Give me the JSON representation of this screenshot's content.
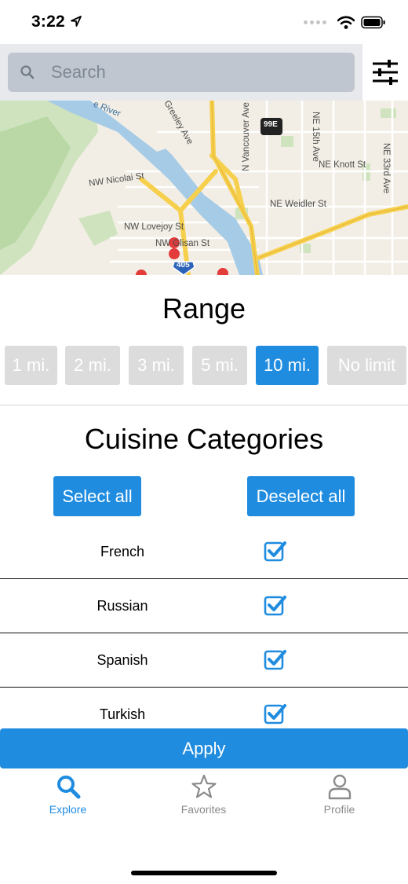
{
  "status_bar": {
    "time": "3:22"
  },
  "search": {
    "placeholder": "Search"
  },
  "map": {
    "labels": {
      "river": "e River",
      "greeley": "Greeley Ave",
      "vancouver": "N Vancouver Ave",
      "ne15": "NE 15th Ave",
      "ne33": "NE 33rd Ave",
      "knott": "NE Knott St",
      "nicolai": "NW Nicolai St",
      "weidler": "NE Weidler St",
      "lovejoy": "NW Lovejoy St",
      "glisan": "NW Glisan St",
      "shield99": "99E",
      "shield405": "405"
    }
  },
  "range": {
    "title": "Range",
    "options": [
      "1 mi.",
      "2 mi.",
      "3 mi.",
      "5 mi.",
      "10 mi.",
      "No limit"
    ],
    "selected": "10 mi."
  },
  "cuisine": {
    "title": "Cuisine Categories",
    "select_all": "Select all",
    "deselect_all": "Deselect all",
    "items": [
      {
        "name": "French",
        "checked": true
      },
      {
        "name": "Russian",
        "checked": true
      },
      {
        "name": "Spanish",
        "checked": true
      },
      {
        "name": "Turkish",
        "checked": true
      }
    ]
  },
  "apply_label": "Apply",
  "tabs": [
    {
      "label": "Explore",
      "icon": "search-icon",
      "active": true
    },
    {
      "label": "Favorites",
      "icon": "star-icon",
      "active": false
    },
    {
      "label": "Profile",
      "icon": "person-icon",
      "active": false
    }
  ],
  "colors": {
    "accent": "#1f8ce0",
    "inactive": "#dcdcdc"
  }
}
